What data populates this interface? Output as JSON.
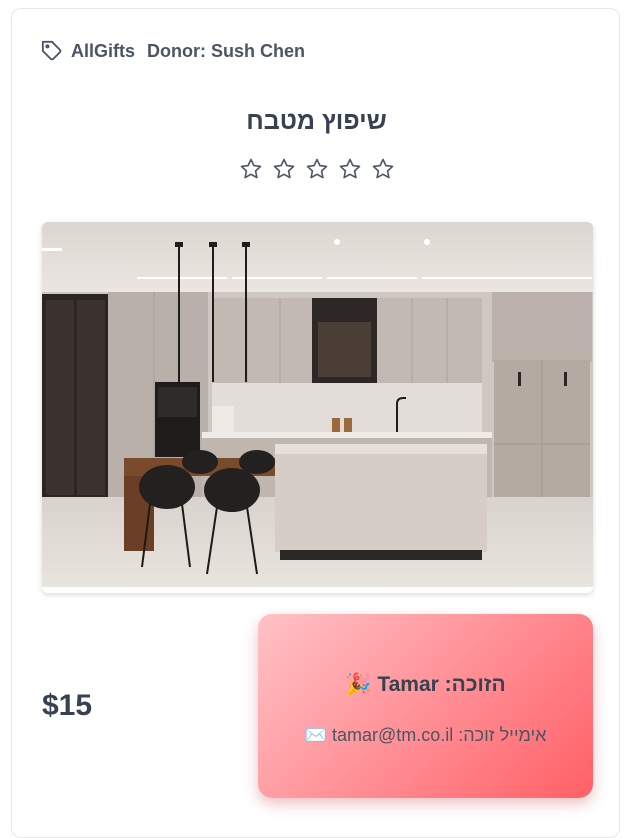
{
  "header": {
    "brand": "AllGifts",
    "donor": "Donor: Sush Chen",
    "icon": "tag-icon"
  },
  "gift": {
    "title": "שיפוץ מטבח",
    "rating": {
      "value": 0,
      "max": 5,
      "icon": "star-outline-icon"
    },
    "image_subject": "modern kitchen photo",
    "price": "$15"
  },
  "winner": {
    "label": "הזוכה:",
    "name": "Tamar",
    "emoji": "🎉",
    "email_label": "אימייל זוכה:",
    "email": "tamar@tm.co.il",
    "email_emoji": "✉️",
    "gradient_colors": [
      "#ffc2c7",
      "#ff6066"
    ]
  }
}
